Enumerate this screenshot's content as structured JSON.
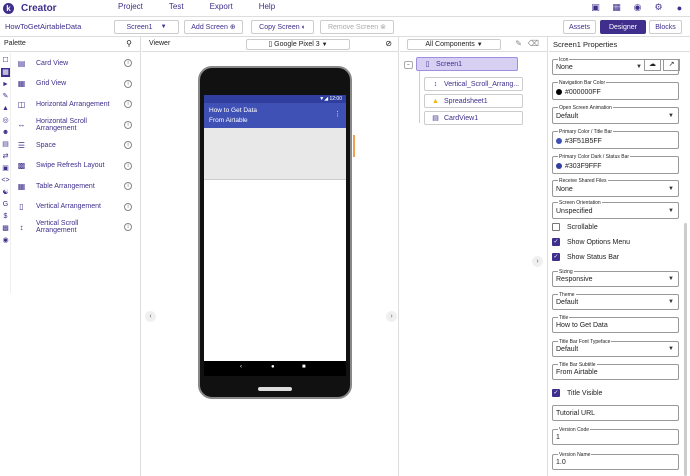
{
  "app": {
    "name": "Creator",
    "logo_letter": "k"
  },
  "menu": [
    "Project",
    "Test",
    "Export",
    "Help"
  ],
  "toolbar": {
    "project_name": "HowToGetAirtableData",
    "screen": "Screen1",
    "add_screen": "Add Screen",
    "copy_screen": "Copy Screen",
    "remove_screen": "Remove Screen",
    "assets": "Assets",
    "designer": "Designer",
    "blocks": "Blocks"
  },
  "palette": {
    "title": "Palette",
    "items": [
      {
        "label": "Card View",
        "icon": "card-view-icon"
      },
      {
        "label": "Grid View",
        "icon": "grid-view-icon"
      },
      {
        "label": "Horizontal Arrangement",
        "icon": "horizontal-arrangement-icon"
      },
      {
        "label": "Horizontal Scroll Arrangement",
        "icon": "horizontal-scroll-icon"
      },
      {
        "label": "Space",
        "icon": "space-icon"
      },
      {
        "label": "Swipe Refresh Layout",
        "icon": "swipe-refresh-icon"
      },
      {
        "label": "Table Arrangement",
        "icon": "table-icon"
      },
      {
        "label": "Vertical Arrangement",
        "icon": "vertical-arrangement-icon"
      },
      {
        "label": "Vertical Scroll Arrangement",
        "icon": "vertical-scroll-icon"
      }
    ]
  },
  "viewer": {
    "title": "Viewer",
    "device": "Google Pixel 3",
    "status_time": "12:00",
    "app_title": "How to Get Data",
    "app_subtitle": "From Airtable"
  },
  "components": {
    "filter": "All Components",
    "tree": [
      {
        "label": "Screen1",
        "selected": true
      },
      {
        "label": "Vertical_Scroll_Arrang...",
        "selected": false
      },
      {
        "label": "Spreadsheet1",
        "selected": false
      },
      {
        "label": "CardView1",
        "selected": false
      }
    ]
  },
  "properties": {
    "title": "Screen1 Properties",
    "icon": {
      "label": "Icon",
      "value": "None"
    },
    "nav_bar_color": {
      "label": "Navigation Bar Color",
      "value": "#000000FF",
      "swatch": "#000000"
    },
    "open_screen_animation": {
      "label": "Open Screen Animation",
      "value": "Default"
    },
    "primary_color": {
      "label": "Primary Color / Title Bar",
      "value": "#3F51B5FF",
      "swatch": "#3F51B5"
    },
    "primary_color_dark": {
      "label": "Primary Color Dark / Status Bar",
      "value": "#303F9FFF",
      "swatch": "#303F9F"
    },
    "receive_shared_files": {
      "label": "Receive Shared Files",
      "value": "None"
    },
    "screen_orientation": {
      "label": "Screen Orientation",
      "value": "Unspecified"
    },
    "scrollable": {
      "label": "Scrollable",
      "checked": false
    },
    "show_options_menu": {
      "label": "Show Options Menu",
      "checked": true
    },
    "show_status_bar": {
      "label": "Show Status Bar",
      "checked": true
    },
    "sizing": {
      "label": "Sizing",
      "value": "Responsive"
    },
    "theme": {
      "label": "Theme",
      "value": "Default"
    },
    "title_prop": {
      "label": "Title",
      "value": "How to Get Data"
    },
    "title_font": {
      "label": "Title Bar Font Typeface",
      "value": "Default"
    },
    "title_subtitle": {
      "label": "Title Bar Subtitle",
      "value": "From Airtable"
    },
    "title_visible": {
      "label": "Title Visible",
      "checked": true
    },
    "tutorial_url": {
      "label": "Tutorial URL",
      "value": ""
    },
    "version_code": {
      "label": "Version Code",
      "value": "1"
    },
    "version_name": {
      "label": "Version Name",
      "value": "1.0"
    }
  },
  "colors": {
    "brand": "#3f2e8c",
    "title_bar": "#3f51b5",
    "status_bar": "#303f9f"
  }
}
